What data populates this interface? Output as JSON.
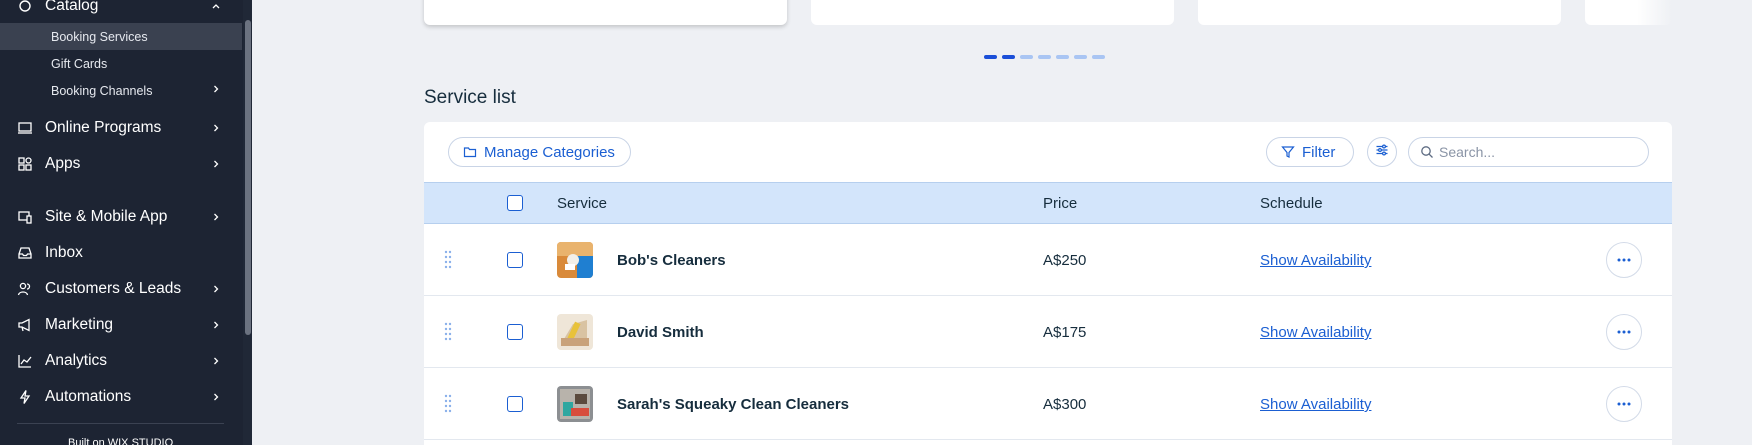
{
  "sidebar": {
    "catalog": "Catalog",
    "sub": [
      "Booking Services",
      "Gift Cards",
      "Booking Channels"
    ],
    "items": [
      "Online Programs",
      "Apps",
      "Site & Mobile App",
      "Inbox",
      "Customers & Leads",
      "Marketing",
      "Analytics",
      "Automations"
    ],
    "built_on": "Built on WIX STUDIO"
  },
  "section_title": "Service list",
  "toolbar": {
    "manage_categories": "Manage Categories",
    "filter": "Filter",
    "search_placeholder": "Search..."
  },
  "table": {
    "headers": {
      "service": "Service",
      "price": "Price",
      "schedule": "Schedule"
    },
    "rows": [
      {
        "name": "Bob's Cleaners",
        "price": "A$250",
        "schedule": "Show Availability"
      },
      {
        "name": "David Smith",
        "price": "A$175",
        "schedule": "Show Availability"
      },
      {
        "name": "Sarah's Squeaky Clean Cleaners",
        "price": "A$300",
        "schedule": "Show Availability"
      }
    ]
  },
  "colors": {
    "accent": "#1b5fd2",
    "sidebar_bg": "#1d2433",
    "header_bg": "#d3e5fb"
  }
}
